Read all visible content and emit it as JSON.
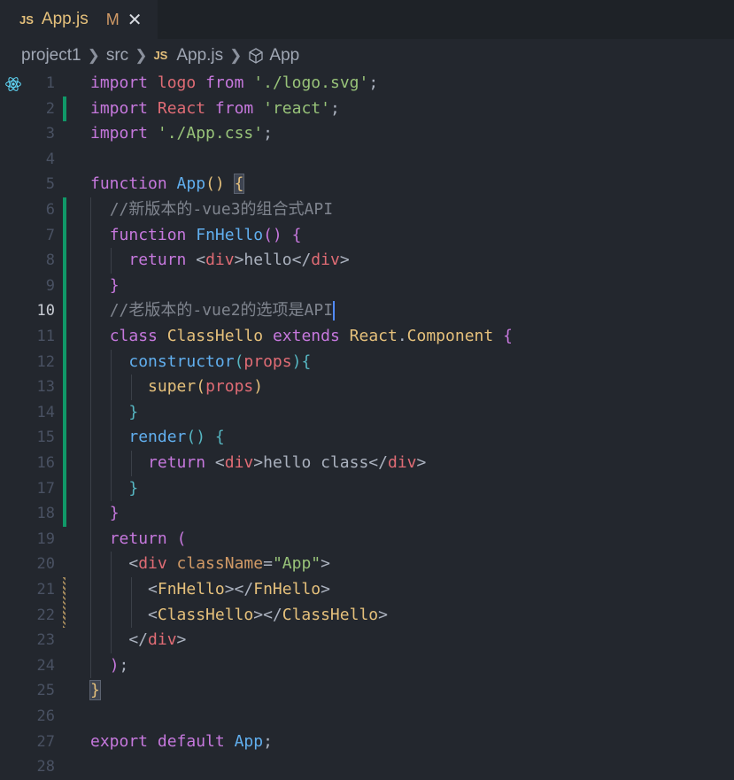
{
  "tab": {
    "icon": "JS",
    "name": "App.js",
    "status": "M",
    "close": "✕"
  },
  "breadcrumb": {
    "items": [
      "project1",
      "src",
      "App.js",
      "App"
    ],
    "file_icon": "JS"
  },
  "lines": [
    {
      "n": "1",
      "tokens": [
        [
          "kw",
          "import"
        ],
        [
          "plain",
          " "
        ],
        [
          "var",
          "logo"
        ],
        [
          "plain",
          " "
        ],
        [
          "kw",
          "from"
        ],
        [
          "plain",
          " "
        ],
        [
          "str",
          "'./logo.svg'"
        ],
        [
          "plain",
          ";"
        ]
      ]
    },
    {
      "n": "2",
      "tokens": [
        [
          "kw",
          "import"
        ],
        [
          "plain",
          " "
        ],
        [
          "var",
          "React"
        ],
        [
          "plain",
          " "
        ],
        [
          "kw",
          "from"
        ],
        [
          "plain",
          " "
        ],
        [
          "str",
          "'react'"
        ],
        [
          "plain",
          ";"
        ]
      ]
    },
    {
      "n": "3",
      "tokens": [
        [
          "kw",
          "import"
        ],
        [
          "plain",
          " "
        ],
        [
          "str",
          "'./App.css'"
        ],
        [
          "plain",
          ";"
        ]
      ]
    },
    {
      "n": "4",
      "tokens": []
    },
    {
      "n": "5",
      "tokens": [
        [
          "kw",
          "function"
        ],
        [
          "plain",
          " "
        ],
        [
          "fn",
          "App"
        ],
        [
          "p1",
          "()"
        ],
        [
          "plain",
          " "
        ],
        [
          "p1 bracket-hl",
          "{"
        ]
      ]
    },
    {
      "n": "6",
      "tokens": [
        [
          "plain",
          "  "
        ],
        [
          "cm",
          "//新版本的-vue3的组合式API"
        ]
      ]
    },
    {
      "n": "7",
      "tokens": [
        [
          "plain",
          "  "
        ],
        [
          "kw",
          "function"
        ],
        [
          "plain",
          " "
        ],
        [
          "fn",
          "FnHello"
        ],
        [
          "p2",
          "()"
        ],
        [
          "plain",
          " "
        ],
        [
          "p2",
          "{"
        ]
      ]
    },
    {
      "n": "8",
      "tokens": [
        [
          "plain",
          "    "
        ],
        [
          "kw",
          "return"
        ],
        [
          "plain",
          " <"
        ],
        [
          "tag",
          "div"
        ],
        [
          "plain",
          ">hello</"
        ],
        [
          "tag",
          "div"
        ],
        [
          "plain",
          ">"
        ]
      ]
    },
    {
      "n": "9",
      "tokens": [
        [
          "plain",
          "  "
        ],
        [
          "p2",
          "}"
        ]
      ]
    },
    {
      "n": "10",
      "tokens": [
        [
          "plain",
          "  "
        ],
        [
          "cm",
          "//老版本的-vue2的选项是API"
        ]
      ],
      "cursor": true
    },
    {
      "n": "11",
      "tokens": [
        [
          "plain",
          "  "
        ],
        [
          "kw",
          "class"
        ],
        [
          "plain",
          " "
        ],
        [
          "cls",
          "ClassHello"
        ],
        [
          "plain",
          " "
        ],
        [
          "kw",
          "extends"
        ],
        [
          "plain",
          " "
        ],
        [
          "cls",
          "React"
        ],
        [
          "plain",
          "."
        ],
        [
          "cls",
          "Component"
        ],
        [
          "plain",
          " "
        ],
        [
          "p2",
          "{"
        ]
      ]
    },
    {
      "n": "12",
      "tokens": [
        [
          "plain",
          "    "
        ],
        [
          "fn",
          "constructor"
        ],
        [
          "p3",
          "("
        ],
        [
          "var",
          "props"
        ],
        [
          "p3",
          ")"
        ],
        [
          "p3",
          "{"
        ]
      ]
    },
    {
      "n": "13",
      "tokens": [
        [
          "plain",
          "      "
        ],
        [
          "cls",
          "super"
        ],
        [
          "p1",
          "("
        ],
        [
          "var",
          "props"
        ],
        [
          "p1",
          ")"
        ]
      ]
    },
    {
      "n": "14",
      "tokens": [
        [
          "plain",
          "    "
        ],
        [
          "p3",
          "}"
        ]
      ]
    },
    {
      "n": "15",
      "tokens": [
        [
          "plain",
          "    "
        ],
        [
          "fn",
          "render"
        ],
        [
          "p3",
          "()"
        ],
        [
          "plain",
          " "
        ],
        [
          "p3",
          "{"
        ]
      ]
    },
    {
      "n": "16",
      "tokens": [
        [
          "plain",
          "      "
        ],
        [
          "kw",
          "return"
        ],
        [
          "plain",
          " <"
        ],
        [
          "tag",
          "div"
        ],
        [
          "plain",
          ">hello class</"
        ],
        [
          "tag",
          "div"
        ],
        [
          "plain",
          ">"
        ]
      ]
    },
    {
      "n": "17",
      "tokens": [
        [
          "plain",
          "    "
        ],
        [
          "p3",
          "}"
        ]
      ]
    },
    {
      "n": "18",
      "tokens": [
        [
          "plain",
          "  "
        ],
        [
          "p2",
          "}"
        ]
      ]
    },
    {
      "n": "19",
      "tokens": [
        [
          "plain",
          "  "
        ],
        [
          "kw",
          "return"
        ],
        [
          "plain",
          " "
        ],
        [
          "p2",
          "("
        ]
      ]
    },
    {
      "n": "20",
      "tokens": [
        [
          "plain",
          "    <"
        ],
        [
          "tag",
          "div"
        ],
        [
          "plain",
          " "
        ],
        [
          "attr",
          "className"
        ],
        [
          "plain",
          "="
        ],
        [
          "str",
          "\"App\""
        ],
        [
          "plain",
          ">"
        ]
      ]
    },
    {
      "n": "21",
      "tokens": [
        [
          "plain",
          "      <"
        ],
        [
          "cls",
          "FnHello"
        ],
        [
          "plain",
          "></"
        ],
        [
          "cls",
          "FnHello"
        ],
        [
          "plain",
          ">"
        ]
      ]
    },
    {
      "n": "22",
      "tokens": [
        [
          "plain",
          "      <"
        ],
        [
          "cls",
          "ClassHello"
        ],
        [
          "plain",
          "></"
        ],
        [
          "cls",
          "ClassHello"
        ],
        [
          "plain",
          ">"
        ]
      ]
    },
    {
      "n": "23",
      "tokens": [
        [
          "plain",
          "    </"
        ],
        [
          "tag",
          "div"
        ],
        [
          "plain",
          ">"
        ]
      ]
    },
    {
      "n": "24",
      "tokens": [
        [
          "plain",
          "  "
        ],
        [
          "p2",
          ")"
        ],
        [
          "plain",
          ";"
        ]
      ]
    },
    {
      "n": "25",
      "tokens": [
        [
          "p1 bracket-hl",
          "}"
        ]
      ]
    },
    {
      "n": "26",
      "tokens": []
    },
    {
      "n": "27",
      "tokens": [
        [
          "kw",
          "export"
        ],
        [
          "plain",
          " "
        ],
        [
          "kw",
          "default"
        ],
        [
          "plain",
          " "
        ],
        [
          "fn",
          "App"
        ],
        [
          "plain",
          ";"
        ]
      ]
    },
    {
      "n": "28",
      "tokens": []
    }
  ],
  "active_line": "10",
  "gutter": {
    "added": [
      "2",
      "6",
      "7",
      "8",
      "9",
      "10",
      "11",
      "12",
      "13",
      "14",
      "15",
      "16",
      "17",
      "18"
    ],
    "modified": [
      "21",
      "22"
    ]
  },
  "colors": {
    "background": "#23272e",
    "added": "#109868",
    "cursor": "#528bff"
  }
}
